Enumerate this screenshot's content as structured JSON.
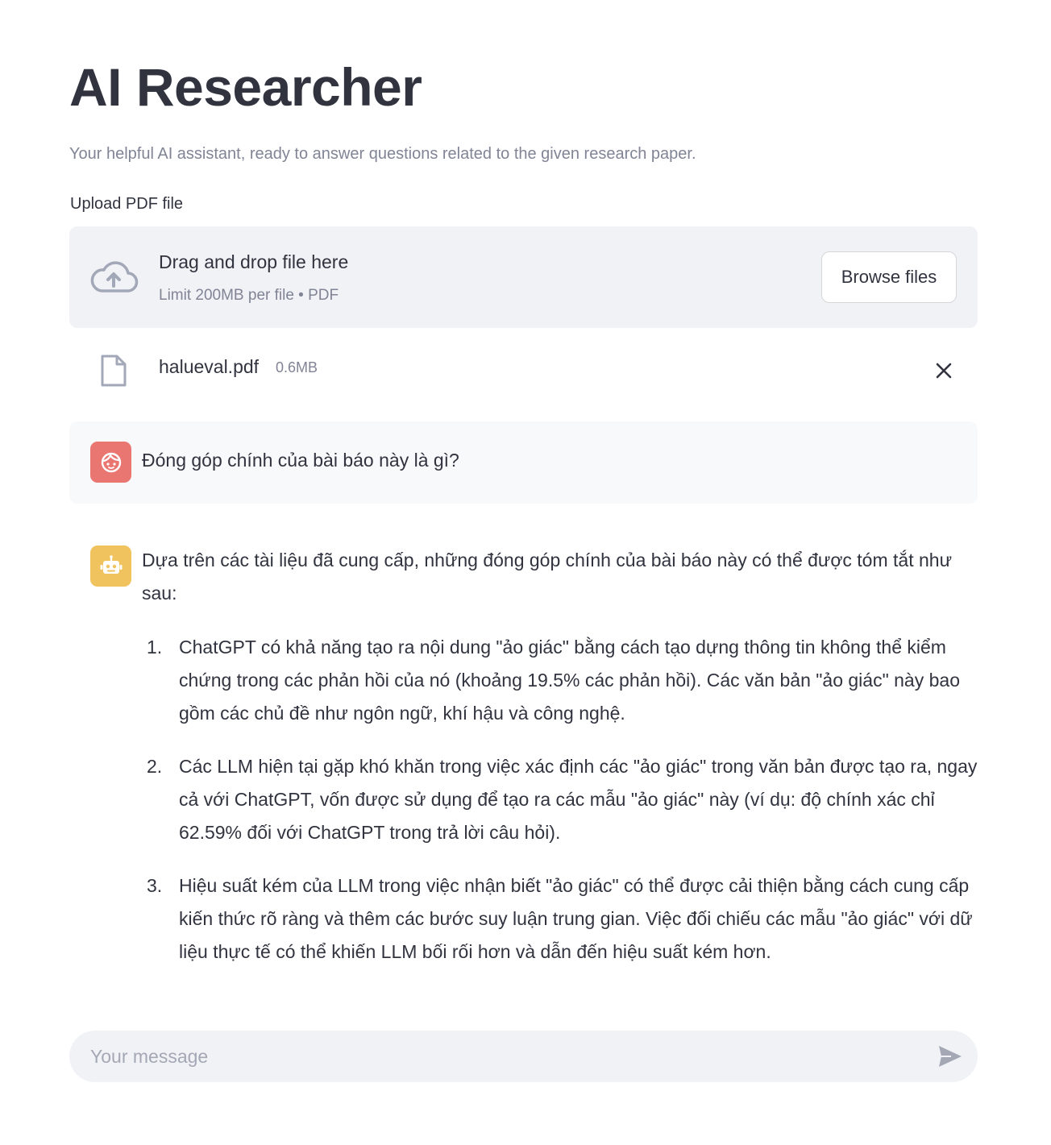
{
  "app": {
    "title": "AI Researcher",
    "subtitle": "Your helpful AI assistant, ready to answer questions related to the given research paper."
  },
  "uploader": {
    "label": "Upload PDF file",
    "drop_title": "Drag and drop file here",
    "limit": "Limit 200MB per file • PDF",
    "browse_label": "Browse files",
    "file": {
      "name": "halueval.pdf",
      "size": "0.6MB"
    }
  },
  "chat": {
    "user_message": "Đóng góp chính của bài báo này là gì?",
    "assistant": {
      "intro": "Dựa trên các tài liệu đã cung cấp, những đóng góp chính của bài báo này có thể được tóm tắt như sau:",
      "points": [
        {
          "num": "1.",
          "text": "ChatGPT có khả năng tạo ra nội dung \"ảo giác\" bằng cách tạo dựng thông tin không thể kiểm chứng trong các phản hồi của nó (khoảng 19.5% các phản hồi). Các văn bản \"ảo giác\" này bao gồm các chủ đề như ngôn ngữ, khí hậu và công nghệ."
        },
        {
          "num": "2.",
          "text": "Các LLM hiện tại gặp khó khăn trong việc xác định các \"ảo giác\" trong văn bản được tạo ra, ngay cả với ChatGPT, vốn được sử dụng để tạo ra các mẫu \"ảo giác\" này (ví dụ: độ chính xác chỉ 62.59% đối với ChatGPT trong trả lời câu hỏi)."
        },
        {
          "num": "3.",
          "text": "Hiệu suất kém của LLM trong việc nhận biết \"ảo giác\" có thể được cải thiện bằng cách cung cấp kiến thức rõ ràng và thêm các bước suy luận trung gian. Việc đối chiếu các mẫu \"ảo giác\" với dữ liệu thực tế có thể khiến LLM bối rối hơn và dẫn đến hiệu suất kém hơn."
        }
      ]
    },
    "input": {
      "placeholder": "Your message",
      "value": ""
    }
  },
  "colors": {
    "text": "#31333f",
    "muted": "#808495",
    "dropzone_bg": "#f0f2f6",
    "user_avatar": "#ea7672",
    "assistant_avatar": "#f0c35e"
  },
  "icons": {
    "upload": "cloud-upload-icon",
    "file": "file-icon",
    "remove": "close-icon",
    "user_avatar": "face-icon",
    "assistant_avatar": "robot-icon",
    "send": "send-icon"
  }
}
